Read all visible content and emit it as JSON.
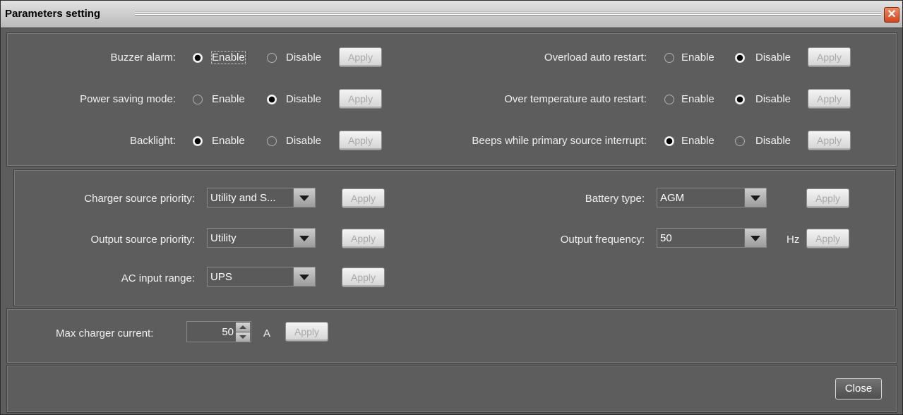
{
  "window": {
    "title": "Parameters setting"
  },
  "apply_label": "Apply",
  "enable_label": "Enable",
  "disable_label": "Disable",
  "toggles": [
    {
      "label": "Buzzer alarm:",
      "selected": "Enable"
    },
    {
      "label": "Power saving mode:",
      "selected": "Disable"
    },
    {
      "label": "Backlight:",
      "selected": "Enable"
    },
    {
      "label": "Overload auto restart:",
      "selected": "Disable"
    },
    {
      "label": "Over temperature auto restart:",
      "selected": "Disable"
    },
    {
      "label": "Beeps while primary source interrupt:",
      "selected": "Enable"
    }
  ],
  "selects": {
    "charger_source_priority": {
      "label": "Charger source priority:",
      "value": "Utility and S..."
    },
    "output_source_priority": {
      "label": "Output source priority:",
      "value": "Utility"
    },
    "ac_input_range": {
      "label": "AC input range:",
      "value": "UPS"
    },
    "battery_type": {
      "label": "Battery type:",
      "value": "AGM"
    },
    "output_frequency": {
      "label": "Output frequency:",
      "value": "50",
      "unit": "Hz"
    }
  },
  "max_charger_current": {
    "label": "Max charger current:",
    "value": "50",
    "unit": "A"
  },
  "close_label": "Close",
  "colors": {
    "background": "#5d5d5d",
    "title_bar": "#c8c8c8",
    "close_icon": "#e05a2a"
  },
  "icons": [
    "close-icon",
    "dropdown-arrow-icon",
    "spinner-up-icon",
    "spinner-down-icon"
  ]
}
